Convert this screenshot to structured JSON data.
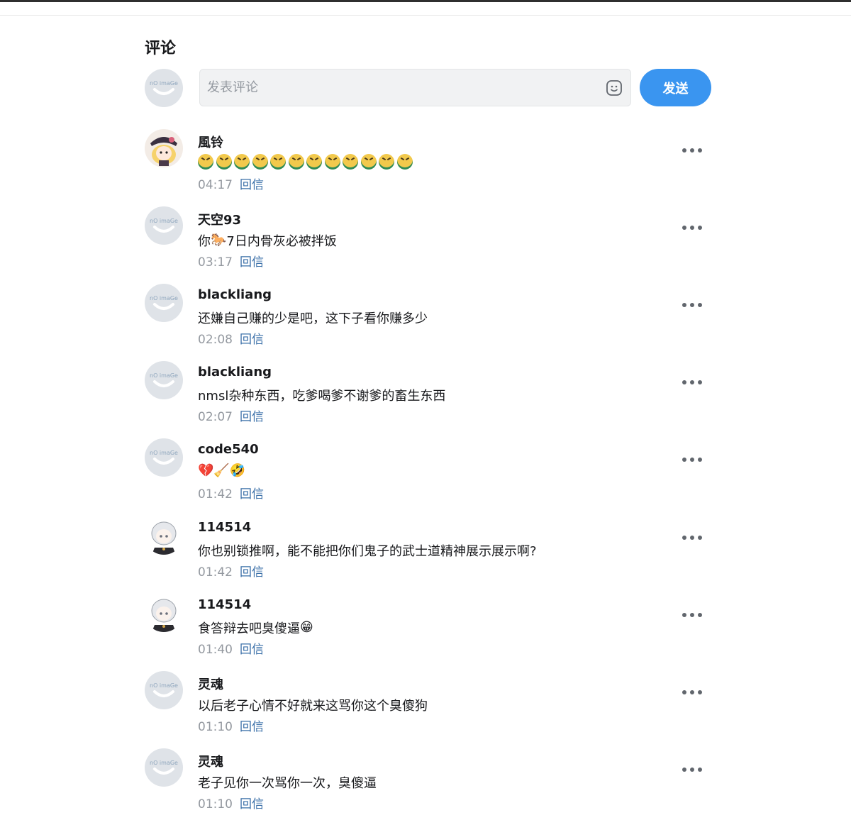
{
  "section": {
    "title": "评论"
  },
  "composer": {
    "placeholder": "发表评论",
    "send_label": "发送",
    "emoji_icon": "smiley-icon"
  },
  "colors": {
    "accent": "#3a95f0",
    "reply_link": "#3a6fa8",
    "muted": "#9499a0"
  },
  "reply_label": "回信",
  "comments": [
    {
      "user": "風铃",
      "text": "",
      "emojis": 12,
      "time": "04:17",
      "avatar": "anime-girl-hat"
    },
    {
      "user": "天空93",
      "text_before": "你",
      "icon": "horse-icon",
      "text_after": "7日内骨灰必被拌饭",
      "time": "03:17",
      "avatar": "noimage"
    },
    {
      "user": "blackliang",
      "text": "还嫌自己赚的少是吧，这下子看你赚多少",
      "time": "02:08",
      "avatar": "noimage"
    },
    {
      "user": "blackliang",
      "text": "nmsl杂种东西，吃爹喝爹不谢爹的畜生东西",
      "time": "02:07",
      "avatar": "noimage"
    },
    {
      "user": "code540",
      "text": "",
      "icons": [
        "broken-heart-icon",
        "broom-icon",
        "laughing-face-icon"
      ],
      "time": "01:42",
      "avatar": "noimage"
    },
    {
      "user": "114514",
      "text": "你也别锁推啊，能不能把你们鬼子的武士道精神展示展示啊?",
      "time": "01:42",
      "avatar": "anime-silver-hair"
    },
    {
      "user": "114514",
      "text_before": "食答辩去吧臭傻逼",
      "icon": "grinning-face-icon",
      "time": "01:40",
      "avatar": "anime-silver-hair"
    },
    {
      "user": "灵魂",
      "text": "以后老子心情不好就来这骂你这个臭傻狗",
      "time": "01:10",
      "avatar": "noimage"
    },
    {
      "user": "灵魂",
      "text": "老子见你一次骂你一次，臭傻逼",
      "time": "01:10",
      "avatar": "noimage"
    }
  ]
}
